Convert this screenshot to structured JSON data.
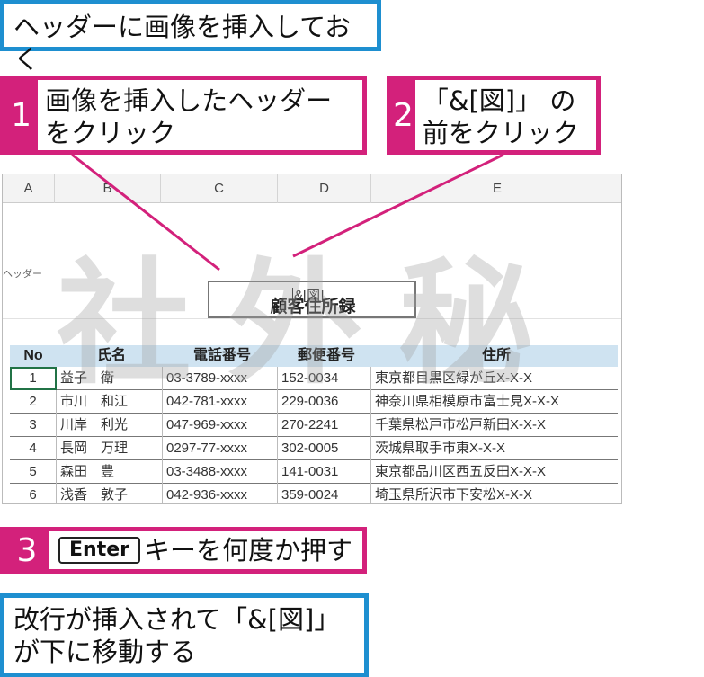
{
  "title": "ヘッダーに画像を挿入しておく",
  "steps": [
    {
      "num": "1",
      "text": "画像を挿入したヘッダーをクリック"
    },
    {
      "num": "2",
      "text": "「&[図]」 の前をクリック"
    },
    {
      "num": "3",
      "key": "Enter",
      "text": "キーを何度か押す"
    }
  ],
  "result": "改行が挿入されて「&[図]」が下に移動する",
  "sheet": {
    "columns": [
      "A",
      "B",
      "C",
      "D",
      "E"
    ],
    "header_label": "ヘッダー",
    "header_cell_value": "&[図]",
    "doc_title": "顧客住所録",
    "watermark": "社外秘",
    "table_headers": [
      "No",
      "氏名",
      "電話番号",
      "郵便番号",
      "住所"
    ],
    "rows": [
      [
        "1",
        "益子　衛",
        "03-3789-xxxx",
        "152-0034",
        "東京都目黒区緑が丘X-X-X"
      ],
      [
        "2",
        "市川　和江",
        "042-781-xxxx",
        "229-0036",
        "神奈川県相模原市富士見X-X-X"
      ],
      [
        "3",
        "川岸　利光",
        "047-969-xxxx",
        "270-2241",
        "千葉県松戸市松戸新田X-X-X"
      ],
      [
        "4",
        "長岡　万理",
        "0297-77-xxxx",
        "302-0005",
        "茨城県取手市東X-X-X"
      ],
      [
        "5",
        "森田　豊",
        "03-3488-xxxx",
        "141-0031",
        "東京都品川区西五反田X-X-X"
      ],
      [
        "6",
        "浅香　敦子",
        "042-936-xxxx",
        "359-0024",
        "埼玉県所沢市下安松X-X-X"
      ]
    ]
  },
  "colors": {
    "step_accent": "#d3217b",
    "box_accent": "#1e8fd0",
    "table_header_bg": "#cfe3f1"
  }
}
